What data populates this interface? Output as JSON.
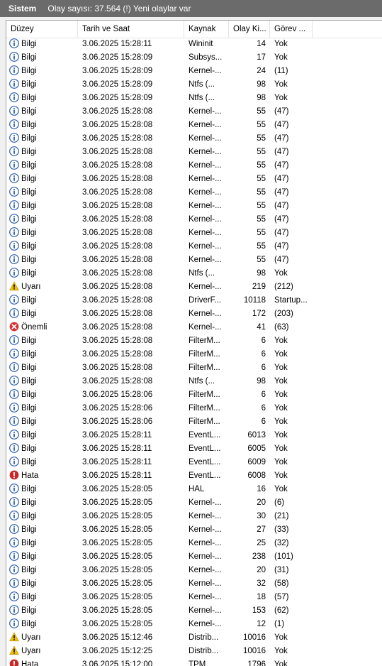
{
  "window": {
    "title": "Sistem",
    "event_info": "Olay sayısı: 37.564 (!) Yeni olaylar var"
  },
  "columns": [
    "Düzey",
    "Tarih ve Saat",
    "Kaynak",
    "Olay Ki...",
    "Görev ..."
  ],
  "icon_names": {
    "Bilgi": "info-icon",
    "Uyarı": "warning-icon",
    "Önemli": "critical-icon",
    "Hata": "error-icon"
  },
  "colors": {
    "info": "#2a5db0",
    "warning": "#f2c200",
    "critical": "#d83030",
    "error": "#c82828"
  },
  "rows": [
    {
      "level": "Bilgi",
      "date": "3.06.2025 15:28:11",
      "source": "Wininit",
      "id": "14",
      "task": "Yok"
    },
    {
      "level": "Bilgi",
      "date": "3.06.2025 15:28:09",
      "source": "Subsys...",
      "id": "17",
      "task": "Yok"
    },
    {
      "level": "Bilgi",
      "date": "3.06.2025 15:28:09",
      "source": "Kernel-...",
      "id": "24",
      "task": "(11)"
    },
    {
      "level": "Bilgi",
      "date": "3.06.2025 15:28:09",
      "source": "Ntfs (...",
      "id": "98",
      "task": "Yok"
    },
    {
      "level": "Bilgi",
      "date": "3.06.2025 15:28:09",
      "source": "Ntfs (...",
      "id": "98",
      "task": "Yok"
    },
    {
      "level": "Bilgi",
      "date": "3.06.2025 15:28:08",
      "source": "Kernel-...",
      "id": "55",
      "task": "(47)"
    },
    {
      "level": "Bilgi",
      "date": "3.06.2025 15:28:08",
      "source": "Kernel-...",
      "id": "55",
      "task": "(47)"
    },
    {
      "level": "Bilgi",
      "date": "3.06.2025 15:28:08",
      "source": "Kernel-...",
      "id": "55",
      "task": "(47)"
    },
    {
      "level": "Bilgi",
      "date": "3.06.2025 15:28:08",
      "source": "Kernel-...",
      "id": "55",
      "task": "(47)"
    },
    {
      "level": "Bilgi",
      "date": "3.06.2025 15:28:08",
      "source": "Kernel-...",
      "id": "55",
      "task": "(47)"
    },
    {
      "level": "Bilgi",
      "date": "3.06.2025 15:28:08",
      "source": "Kernel-...",
      "id": "55",
      "task": "(47)"
    },
    {
      "level": "Bilgi",
      "date": "3.06.2025 15:28:08",
      "source": "Kernel-...",
      "id": "55",
      "task": "(47)"
    },
    {
      "level": "Bilgi",
      "date": "3.06.2025 15:28:08",
      "source": "Kernel-...",
      "id": "55",
      "task": "(47)"
    },
    {
      "level": "Bilgi",
      "date": "3.06.2025 15:28:08",
      "source": "Kernel-...",
      "id": "55",
      "task": "(47)"
    },
    {
      "level": "Bilgi",
      "date": "3.06.2025 15:28:08",
      "source": "Kernel-...",
      "id": "55",
      "task": "(47)"
    },
    {
      "level": "Bilgi",
      "date": "3.06.2025 15:28:08",
      "source": "Kernel-...",
      "id": "55",
      "task": "(47)"
    },
    {
      "level": "Bilgi",
      "date": "3.06.2025 15:28:08",
      "source": "Kernel-...",
      "id": "55",
      "task": "(47)"
    },
    {
      "level": "Bilgi",
      "date": "3.06.2025 15:28:08",
      "source": "Ntfs (...",
      "id": "98",
      "task": "Yok"
    },
    {
      "level": "Uyarı",
      "date": "3.06.2025 15:28:08",
      "source": "Kernel-...",
      "id": "219",
      "task": "(212)"
    },
    {
      "level": "Bilgi",
      "date": "3.06.2025 15:28:08",
      "source": "DriverF...",
      "id": "10118",
      "task": "Startup..."
    },
    {
      "level": "Bilgi",
      "date": "3.06.2025 15:28:08",
      "source": "Kernel-...",
      "id": "172",
      "task": "(203)"
    },
    {
      "level": "Önemli",
      "date": "3.06.2025 15:28:08",
      "source": "Kernel-...",
      "id": "41",
      "task": "(63)"
    },
    {
      "level": "Bilgi",
      "date": "3.06.2025 15:28:08",
      "source": "FilterM...",
      "id": "6",
      "task": "Yok"
    },
    {
      "level": "Bilgi",
      "date": "3.06.2025 15:28:08",
      "source": "FilterM...",
      "id": "6",
      "task": "Yok"
    },
    {
      "level": "Bilgi",
      "date": "3.06.2025 15:28:08",
      "source": "FilterM...",
      "id": "6",
      "task": "Yok"
    },
    {
      "level": "Bilgi",
      "date": "3.06.2025 15:28:08",
      "source": "Ntfs (...",
      "id": "98",
      "task": "Yok"
    },
    {
      "level": "Bilgi",
      "date": "3.06.2025 15:28:06",
      "source": "FilterM...",
      "id": "6",
      "task": "Yok"
    },
    {
      "level": "Bilgi",
      "date": "3.06.2025 15:28:06",
      "source": "FilterM...",
      "id": "6",
      "task": "Yok"
    },
    {
      "level": "Bilgi",
      "date": "3.06.2025 15:28:06",
      "source": "FilterM...",
      "id": "6",
      "task": "Yok"
    },
    {
      "level": "Bilgi",
      "date": "3.06.2025 15:28:11",
      "source": "EventL...",
      "id": "6013",
      "task": "Yok"
    },
    {
      "level": "Bilgi",
      "date": "3.06.2025 15:28:11",
      "source": "EventL...",
      "id": "6005",
      "task": "Yok"
    },
    {
      "level": "Bilgi",
      "date": "3.06.2025 15:28:11",
      "source": "EventL...",
      "id": "6009",
      "task": "Yok"
    },
    {
      "level": "Hata",
      "date": "3.06.2025 15:28:11",
      "source": "EventL...",
      "id": "6008",
      "task": "Yok"
    },
    {
      "level": "Bilgi",
      "date": "3.06.2025 15:28:05",
      "source": "HAL",
      "id": "16",
      "task": "Yok"
    },
    {
      "level": "Bilgi",
      "date": "3.06.2025 15:28:05",
      "source": "Kernel-...",
      "id": "20",
      "task": "(6)"
    },
    {
      "level": "Bilgi",
      "date": "3.06.2025 15:28:05",
      "source": "Kernel-...",
      "id": "30",
      "task": "(21)"
    },
    {
      "level": "Bilgi",
      "date": "3.06.2025 15:28:05",
      "source": "Kernel-...",
      "id": "27",
      "task": "(33)"
    },
    {
      "level": "Bilgi",
      "date": "3.06.2025 15:28:05",
      "source": "Kernel-...",
      "id": "25",
      "task": "(32)"
    },
    {
      "level": "Bilgi",
      "date": "3.06.2025 15:28:05",
      "source": "Kernel-...",
      "id": "238",
      "task": "(101)"
    },
    {
      "level": "Bilgi",
      "date": "3.06.2025 15:28:05",
      "source": "Kernel-...",
      "id": "20",
      "task": "(31)"
    },
    {
      "level": "Bilgi",
      "date": "3.06.2025 15:28:05",
      "source": "Kernel-...",
      "id": "32",
      "task": "(58)"
    },
    {
      "level": "Bilgi",
      "date": "3.06.2025 15:28:05",
      "source": "Kernel-...",
      "id": "18",
      "task": "(57)"
    },
    {
      "level": "Bilgi",
      "date": "3.06.2025 15:28:05",
      "source": "Kernel-...",
      "id": "153",
      "task": "(62)"
    },
    {
      "level": "Bilgi",
      "date": "3.06.2025 15:28:05",
      "source": "Kernel-...",
      "id": "12",
      "task": "(1)"
    },
    {
      "level": "Uyarı",
      "date": "3.06.2025 15:12:46",
      "source": "Distrib...",
      "id": "10016",
      "task": "Yok"
    },
    {
      "level": "Uyarı",
      "date": "3.06.2025 15:12:25",
      "source": "Distrib...",
      "id": "10016",
      "task": "Yok"
    },
    {
      "level": "Hata",
      "date": "3.06.2025 15:12:00",
      "source": "TPM",
      "id": "1796",
      "task": "Yok"
    }
  ]
}
